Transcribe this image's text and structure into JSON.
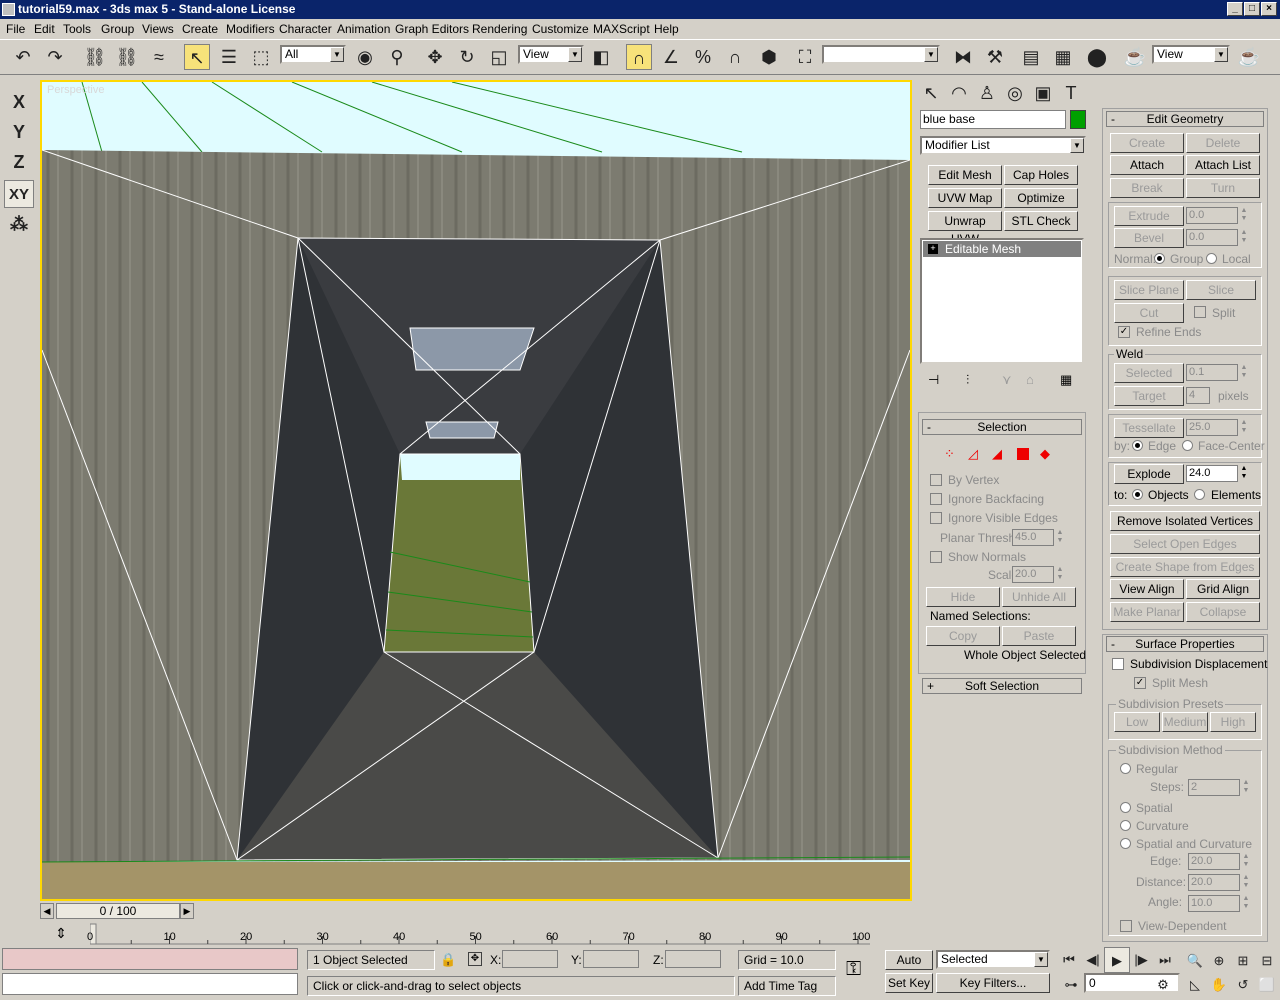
{
  "window": {
    "title": "tutorial59.max - 3ds max 5 - Stand-alone License"
  },
  "menu": [
    "File",
    "Edit",
    "Tools",
    "Group",
    "Views",
    "Create",
    "Modifiers",
    "Character",
    "Animation",
    "Graph Editors",
    "Rendering",
    "Customize",
    "MAXScript",
    "Help"
  ],
  "toolbar": {
    "selection_filter": "All",
    "ref_coord": "View",
    "named_sel": "",
    "render_type": "View"
  },
  "left_toolbar": {
    "axes": [
      "X",
      "Y",
      "Z",
      "XY"
    ]
  },
  "viewport": {
    "label": "Perspective",
    "border_color": "#ffd800"
  },
  "command_panel": {
    "object_name": "blue base",
    "object_color": "#00a000",
    "modifier_list": "Modifier List",
    "modifier_buttons": [
      "Edit Mesh",
      "Cap Holes",
      "UVW Map",
      "Optimize",
      "Unwrap UVW",
      "STL Check"
    ],
    "stack_item": "Editable Mesh"
  },
  "selection": {
    "header": "Selection",
    "by_vertex": "By Vertex",
    "ignore_backfacing": "Ignore Backfacing",
    "ignore_visible_edges": "Ignore Visible Edges",
    "planar_thresh_label": "Planar Thresh:",
    "planar_thresh": "45.0",
    "show_normals": "Show Normals",
    "scale_label": "Scale:",
    "scale": "20.0",
    "hide": "Hide",
    "unhide_all": "Unhide All",
    "named_selections": "Named Selections:",
    "copy": "Copy",
    "paste": "Paste",
    "status": "Whole Object Selected"
  },
  "soft_selection": {
    "header": "Soft Selection"
  },
  "edit_geometry": {
    "header": "Edit Geometry",
    "create": "Create",
    "delete": "Delete",
    "attach": "Attach",
    "attach_list": "Attach List",
    "break": "Break",
    "turn": "Turn",
    "extrude": "Extrude",
    "extrude_val": "0.0",
    "bevel": "Bevel",
    "bevel_val": "0.0",
    "normal_label": "Normal:",
    "group": "Group",
    "local": "Local",
    "slice_plane": "Slice Plane",
    "slice": "Slice",
    "cut": "Cut",
    "split": "Split",
    "refine_ends": "Refine Ends",
    "weld": "Weld",
    "selected": "Selected",
    "selected_val": "0.1",
    "target": "Target",
    "target_val": "4",
    "pixels": "pixels",
    "tessellate": "Tessellate",
    "tessellate_val": "25.0",
    "by_label": "by:",
    "edge": "Edge",
    "face_center": "Face-Center",
    "explode": "Explode",
    "explode_val": "24.0",
    "to_label": "to:",
    "objects": "Objects",
    "elements": "Elements",
    "remove_isolated": "Remove Isolated Vertices",
    "select_open_edges": "Select Open Edges",
    "create_shape": "Create Shape from Edges",
    "view_align": "View Align",
    "grid_align": "Grid Align",
    "make_planar": "Make Planar",
    "collapse": "Collapse"
  },
  "surface_properties": {
    "header": "Surface Properties",
    "subdivision_displacement": "Subdivision Displacement",
    "split_mesh": "Split Mesh",
    "presets_label": "Subdivision Presets",
    "low": "Low",
    "medium": "Medium",
    "high": "High",
    "method_label": "Subdivision Method",
    "regular": "Regular",
    "steps_label": "Steps:",
    "steps": "2",
    "spatial": "Spatial",
    "curvature": "Curvature",
    "spatial_curvature": "Spatial and Curvature",
    "edge_label": "Edge:",
    "edge_val": "20.0",
    "distance_label": "Distance:",
    "distance_val": "20.0",
    "angle_label": "Angle:",
    "angle_val": "10.0",
    "view_dependent": "View-Dependent"
  },
  "timeline": {
    "frame": "0 / 100",
    "ticks": [
      "0",
      "10",
      "20",
      "30",
      "40",
      "50",
      "60",
      "70",
      "80",
      "90",
      "100"
    ]
  },
  "status": {
    "selected_count": "1 Object Selected",
    "prompt": "Click or click-and-drag to select objects",
    "x_label": "X:",
    "y_label": "Y:",
    "z_label": "Z:",
    "grid": "Grid = 10.0",
    "add_time_tag": "Add Time Tag",
    "auto_key": "Auto Key",
    "set_key": "Set Key",
    "key_mode": "Selected",
    "key_filters": "Key Filters...",
    "current_frame": "0"
  }
}
